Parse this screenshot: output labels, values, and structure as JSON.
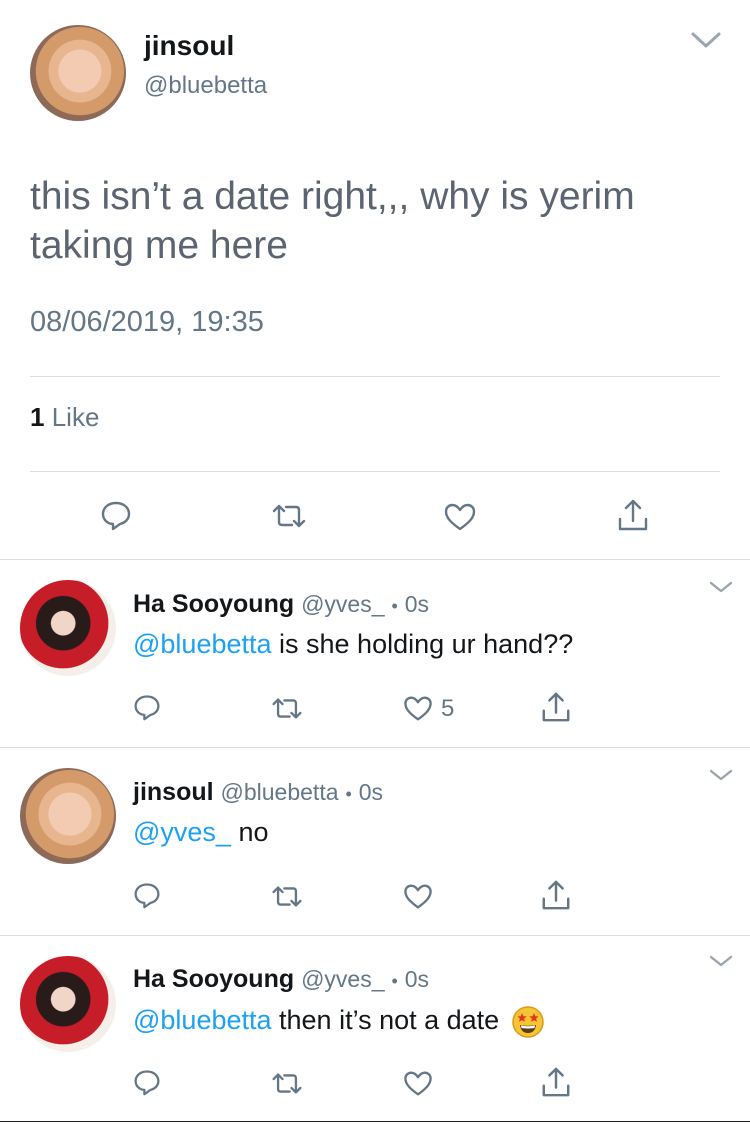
{
  "main_tweet": {
    "name": "jinsoul",
    "handle": "@bluebetta",
    "text": "this isn’t a date right,,, why is yerim taking me here",
    "timestamp": "08/06/2019, 19:35",
    "likes_count": "1",
    "likes_label": "Like"
  },
  "replies": [
    {
      "name": "Ha Sooyoung",
      "handle": "@yves_",
      "sep": "•",
      "time": "0s",
      "mention": "@bluebetta",
      "text": " is she holding ur hand??",
      "like_count": "5"
    },
    {
      "name": "jinsoul",
      "handle": "@bluebetta",
      "sep": "•",
      "time": "0s",
      "mention": "@yves_",
      "text": " no",
      "like_count": ""
    },
    {
      "name": "Ha Sooyoung",
      "handle": "@yves_",
      "sep": "•",
      "time": "0s",
      "mention": "@bluebetta",
      "text": " then it’s not a date",
      "like_count": ""
    }
  ],
  "colors": {
    "mention": "#1da1f2",
    "secondary": "#657786",
    "icon": "#657786"
  }
}
